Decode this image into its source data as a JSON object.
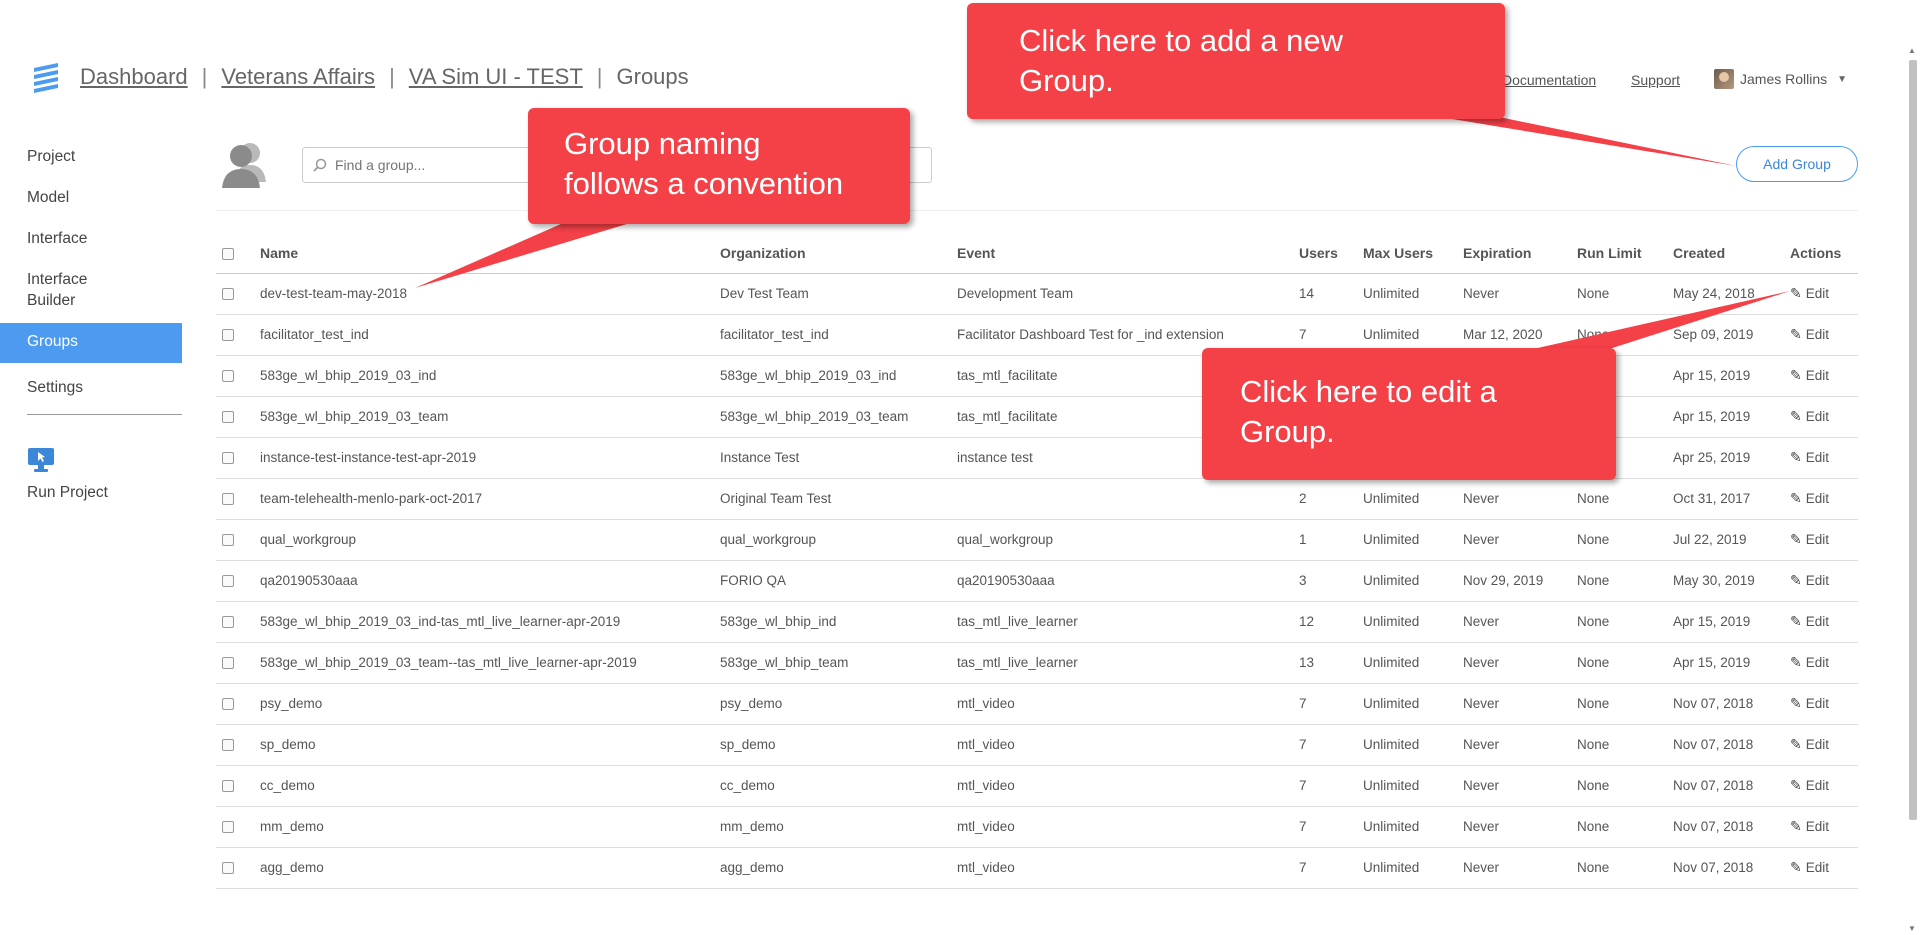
{
  "header": {
    "breadcrumb": [
      "Dashboard",
      "Veterans Affairs",
      "VA Sim UI - TEST"
    ],
    "current": "Groups",
    "separator": "|",
    "nav": {
      "documentation": "Documentation",
      "support": "Support"
    },
    "user_name": "James Rollins"
  },
  "sidebar": {
    "items": [
      {
        "label": "Project"
      },
      {
        "label": "Model"
      },
      {
        "label": "Interface"
      },
      {
        "label": "Interface Builder"
      },
      {
        "label": "Groups"
      },
      {
        "label": "Settings"
      }
    ],
    "run_project": "Run Project"
  },
  "toolbar": {
    "search_placeholder": "Find a group...",
    "add_group_label": "Add Group"
  },
  "table": {
    "columns": [
      "Name",
      "Organization",
      "Event",
      "Users",
      "Max Users",
      "Expiration",
      "Run Limit",
      "Created",
      "Actions"
    ],
    "edit_label": "Edit",
    "rows": [
      {
        "name": "dev-test-team-may-2018",
        "org": "Dev Test Team",
        "event": "Development Team",
        "users": "14",
        "max": "Unlimited",
        "exp": "Never",
        "run": "None",
        "created": "May 24, 2018"
      },
      {
        "name": "facilitator_test_ind",
        "org": "facilitator_test_ind",
        "event": "Facilitator Dashboard Test for _ind extension",
        "users": "7",
        "max": "Unlimited",
        "exp": "Mar 12, 2020",
        "run": "None",
        "created": "Sep 09, 2019"
      },
      {
        "name": "583ge_wl_bhip_2019_03_ind",
        "org": "583ge_wl_bhip_2019_03_ind",
        "event": "tas_mtl_facilitate",
        "users": "",
        "max": "",
        "exp": "",
        "run": "",
        "created": "Apr 15, 2019"
      },
      {
        "name": "583ge_wl_bhip_2019_03_team",
        "org": "583ge_wl_bhip_2019_03_team",
        "event": "tas_mtl_facilitate",
        "users": "",
        "max": "",
        "exp": "",
        "run": "",
        "created": "Apr 15, 2019"
      },
      {
        "name": "instance-test-instance-test-apr-2019",
        "org": "Instance Test",
        "event": "instance test",
        "users": "",
        "max": "",
        "exp": "",
        "run": "",
        "created": "Apr 25, 2019"
      },
      {
        "name": "team-telehealth-menlo-park-oct-2017",
        "org": "Original Team Test",
        "event": "",
        "users": "2",
        "max": "Unlimited",
        "exp": "Never",
        "run": "None",
        "created": "Oct 31, 2017"
      },
      {
        "name": "qual_workgroup",
        "org": "qual_workgroup",
        "event": "qual_workgroup",
        "users": "1",
        "max": "Unlimited",
        "exp": "Never",
        "run": "None",
        "created": "Jul 22, 2019"
      },
      {
        "name": "qa20190530aaa",
        "org": "FORIO QA",
        "event": "qa20190530aaa",
        "users": "3",
        "max": "Unlimited",
        "exp": "Nov 29, 2019",
        "run": "None",
        "created": "May 30, 2019"
      },
      {
        "name": "583ge_wl_bhip_2019_03_ind-tas_mtl_live_learner-apr-2019",
        "org": "583ge_wl_bhip_ind",
        "event": "tas_mtl_live_learner",
        "users": "12",
        "max": "Unlimited",
        "exp": "Never",
        "run": "None",
        "created": "Apr 15, 2019"
      },
      {
        "name": "583ge_wl_bhip_2019_03_team--tas_mtl_live_learner-apr-2019",
        "org": "583ge_wl_bhip_team",
        "event": "tas_mtl_live_learner",
        "users": "13",
        "max": "Unlimited",
        "exp": "Never",
        "run": "None",
        "created": "Apr 15, 2019"
      },
      {
        "name": "psy_demo",
        "org": "psy_demo",
        "event": "mtl_video",
        "users": "7",
        "max": "Unlimited",
        "exp": "Never",
        "run": "None",
        "created": "Nov 07, 2018"
      },
      {
        "name": "sp_demo",
        "org": "sp_demo",
        "event": "mtl_video",
        "users": "7",
        "max": "Unlimited",
        "exp": "Never",
        "run": "None",
        "created": "Nov 07, 2018"
      },
      {
        "name": "cc_demo",
        "org": "cc_demo",
        "event": "mtl_video",
        "users": "7",
        "max": "Unlimited",
        "exp": "Never",
        "run": "None",
        "created": "Nov 07, 2018"
      },
      {
        "name": "mm_demo",
        "org": "mm_demo",
        "event": "mtl_video",
        "users": "7",
        "max": "Unlimited",
        "exp": "Never",
        "run": "None",
        "created": "Nov 07, 2018"
      },
      {
        "name": "agg_demo",
        "org": "agg_demo",
        "event": "mtl_video",
        "users": "7",
        "max": "Unlimited",
        "exp": "Never",
        "run": "None",
        "created": "Nov 07, 2018"
      }
    ]
  },
  "callouts": {
    "add_group": [
      "Click here to add a new",
      "Group."
    ],
    "naming": [
      "Group naming",
      "follows a convention"
    ],
    "edit": [
      "Click here to edit a",
      "Group."
    ]
  },
  "colors": {
    "accent": "#4c9bf0",
    "callout": "#f44047",
    "logo": "#4c9bf0"
  },
  "icons": {
    "logo": "forio-logo-icon",
    "search": "search-icon",
    "group_avatar": "group-users-icon",
    "run_project": "monitor-cursor-icon",
    "edit": "pencil-icon"
  }
}
